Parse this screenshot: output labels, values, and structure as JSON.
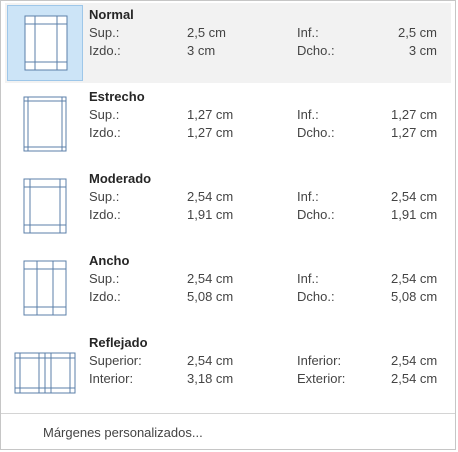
{
  "presets": [
    {
      "name": "Normal",
      "top_label": "Sup.:",
      "top": "2,5 cm",
      "bottom_label": "Inf.:",
      "bottom": "2,5 cm",
      "left_label": "Izdo.:",
      "left": "3 cm",
      "right_label": "Dcho.:",
      "right": "3 cm"
    },
    {
      "name": "Estrecho",
      "top_label": "Sup.:",
      "top": "1,27 cm",
      "bottom_label": "Inf.:",
      "bottom": "1,27 cm",
      "left_label": "Izdo.:",
      "left": "1,27 cm",
      "right_label": "Dcho.:",
      "right": "1,27 cm"
    },
    {
      "name": "Moderado",
      "top_label": "Sup.:",
      "top": "2,54 cm",
      "bottom_label": "Inf.:",
      "bottom": "2,54 cm",
      "left_label": "Izdo.:",
      "left": "1,91 cm",
      "right_label": "Dcho.:",
      "right": "1,91 cm"
    },
    {
      "name": "Ancho",
      "top_label": "Sup.:",
      "top": "2,54 cm",
      "bottom_label": "Inf.:",
      "bottom": "2,54 cm",
      "left_label": "Izdo.:",
      "left": "5,08 cm",
      "right_label": "Dcho.:",
      "right": "5,08 cm"
    },
    {
      "name": "Reflejado",
      "top_label": "Superior:",
      "top": "2,54 cm",
      "bottom_label": "Inferior:",
      "bottom": "2,54 cm",
      "left_label": "Interior:",
      "left": "3,18 cm",
      "right_label": "Exterior:",
      "right": "2,54 cm"
    }
  ],
  "custom_margins_label": "Márgenes personalizados...",
  "colors": {
    "line": "#5b7fa8",
    "page": "#ffffff",
    "selected_bg": "#cce4f7"
  },
  "icons": [
    "page-margins-normal-icon",
    "page-margins-narrow-icon",
    "page-margins-moderate-icon",
    "page-margins-wide-icon",
    "page-margins-mirrored-icon"
  ]
}
